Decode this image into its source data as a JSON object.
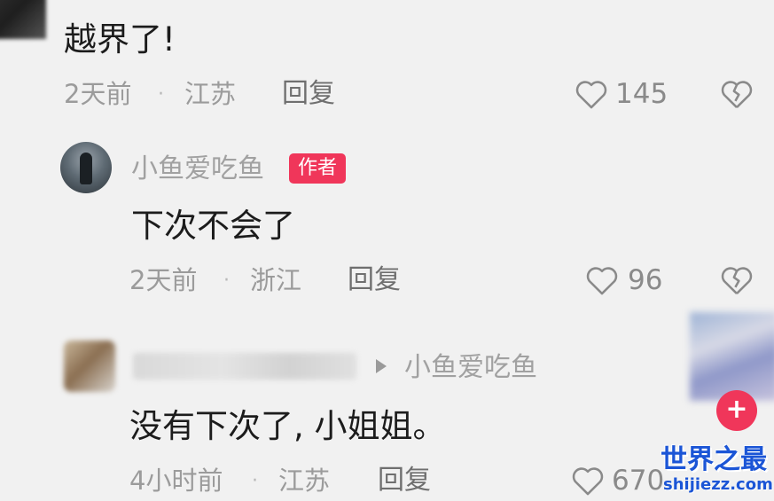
{
  "comments": [
    {
      "text": "越界了!",
      "time": "2天前",
      "separator": "·",
      "location": "江苏",
      "reply_label": "回复",
      "like_count": "145",
      "like_icon": "heart-outline-icon",
      "dislike_icon": "broken-heart-icon"
    },
    {
      "username": "小鱼爱吃鱼",
      "badge": "作者",
      "text": "下次不会了",
      "time": "2天前",
      "separator": "·",
      "location": "浙江",
      "reply_label": "回复",
      "like_count": "96",
      "like_icon": "heart-outline-icon",
      "dislike_icon": "broken-heart-icon"
    },
    {
      "reply_to": "小鱼爱吃鱼",
      "text": "没有下次了, 小姐姐。",
      "time": "4小时前",
      "separator": "·",
      "location": "江苏",
      "reply_label": "回复",
      "like_count": "670",
      "like_icon": "heart-outline-icon"
    }
  ],
  "follow_button": "+",
  "watermark": {
    "title": "世界之最",
    "url": "shijiezz.com"
  },
  "colors": {
    "background": "#f1f1f1",
    "badge": "#f0365a",
    "watermark": "#1b55d6"
  }
}
